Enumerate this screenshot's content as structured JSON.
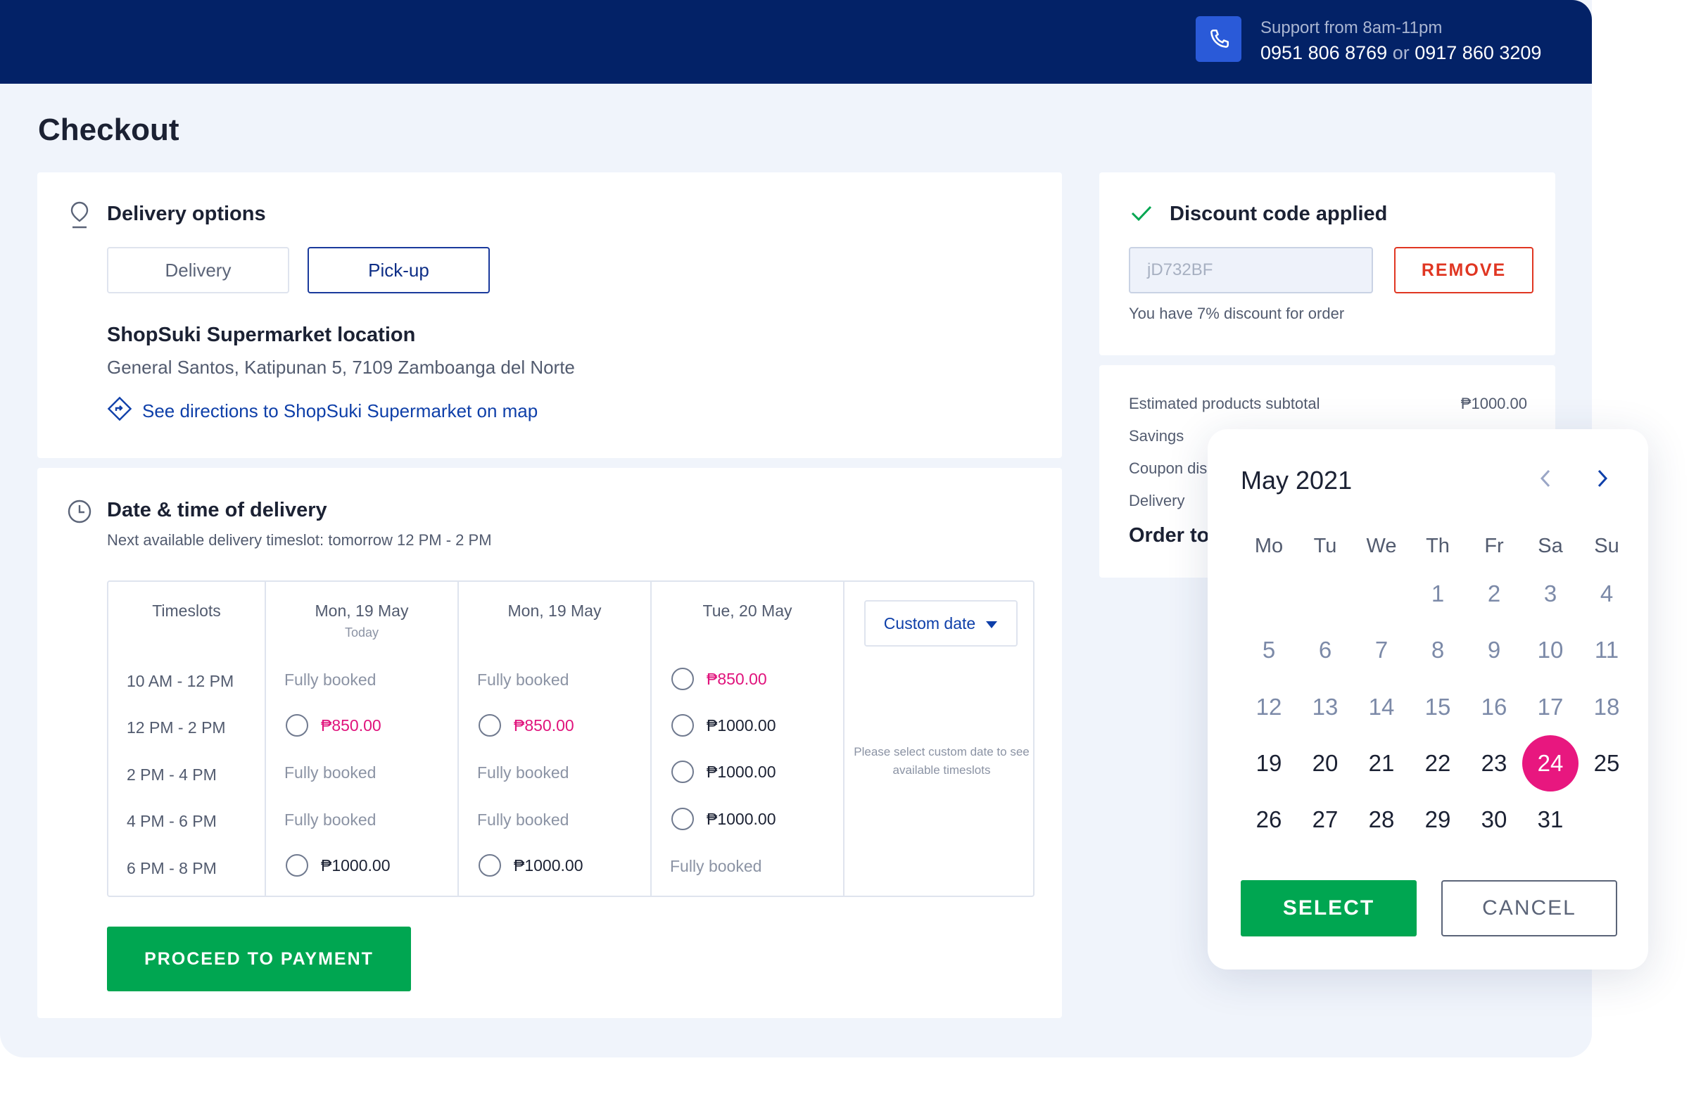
{
  "header": {
    "support_title": "Support from 8am-11pm",
    "phone_1": "0951 806 8769",
    "phone_separator": "or",
    "phone_2": "0917 860 3209",
    "phone_icon": "phone-icon"
  },
  "page": {
    "title": "Checkout"
  },
  "delivery_options": {
    "title": "Delivery options",
    "icon": "location-pin-icon",
    "options": [
      "Delivery",
      "Pick-up"
    ],
    "selected": "Pick-up",
    "store_name": "ShopSuki Supermarket location",
    "store_address": "General Santos, Katipunan 5, 7109 Zamboanga del Norte",
    "directions_link": "See directions to ShopSuki Supermarket on map",
    "directions_icon": "directions-icon"
  },
  "datetime": {
    "title": "Date & time of delivery",
    "icon": "clock-icon",
    "subtitle": "Next available delivery timeslot: tomorrow 12 PM - 2 PM",
    "timeslots_header": "Timeslots",
    "timeslots": [
      "10 AM - 12 PM",
      "12 PM - 2 PM",
      "2 PM - 4 PM",
      "4 PM - 6 PM",
      "6 PM - 8 PM"
    ],
    "days": [
      {
        "label": "Mon, 19 May",
        "sub": "Today",
        "cells": [
          {
            "text": "Fully booked",
            "type": "booked"
          },
          {
            "text": "₱850.00",
            "type": "pink"
          },
          {
            "text": "Fully booked",
            "type": "booked"
          },
          {
            "text": "Fully booked",
            "type": "booked"
          },
          {
            "text": "₱1000.00",
            "type": "dark"
          }
        ]
      },
      {
        "label": "Mon, 19 May",
        "sub": "",
        "cells": [
          {
            "text": "Fully booked",
            "type": "booked"
          },
          {
            "text": "₱850.00",
            "type": "pink"
          },
          {
            "text": "Fully booked",
            "type": "booked"
          },
          {
            "text": "Fully booked",
            "type": "booked"
          },
          {
            "text": "₱1000.00",
            "type": "dark"
          }
        ]
      },
      {
        "label": "Tue, 20 May",
        "sub": "",
        "cells": [
          {
            "text": "₱850.00",
            "type": "pink"
          },
          {
            "text": "₱1000.00",
            "type": "dark"
          },
          {
            "text": "₱1000.00",
            "type": "dark"
          },
          {
            "text": "₱1000.00",
            "type": "dark"
          },
          {
            "text": "Fully booked",
            "type": "booked"
          }
        ]
      }
    ],
    "custom_date_label": "Custom date",
    "custom_note": "Please select custom date to see available timeslots",
    "proceed_label": "PROCEED TO PAYMENT"
  },
  "discount": {
    "title": "Discount code applied",
    "icon": "check-icon",
    "code_value": "jD732BF",
    "remove_label": "REMOVE",
    "note": "You have 7% discount for order"
  },
  "summary": {
    "subtotal_label": "Estimated products subtotal",
    "subtotal_value": "₱1000.00",
    "savings_label": "Savings",
    "coupon_label": "Coupon dis",
    "delivery_label": "Delivery",
    "total_label": "Order to"
  },
  "calendar": {
    "month": "May 2021",
    "weekdays": [
      "Mo",
      "Tu",
      "We",
      "Th",
      "Fr",
      "Sa",
      "Su"
    ],
    "first_weekday_index": 3,
    "days_in_month": 31,
    "today": 19,
    "selected": 24,
    "select_label": "SELECT",
    "cancel_label": "CANCEL",
    "colors": {
      "selected": "#e8177f",
      "past": "#7c8aa8",
      "current": "#1b2133"
    }
  },
  "colors": {
    "header_bg": "#032267",
    "primary": "#00a651",
    "accent_blue": "#0e3fa9",
    "danger": "#e03622",
    "price_pink": "#e0137c"
  }
}
